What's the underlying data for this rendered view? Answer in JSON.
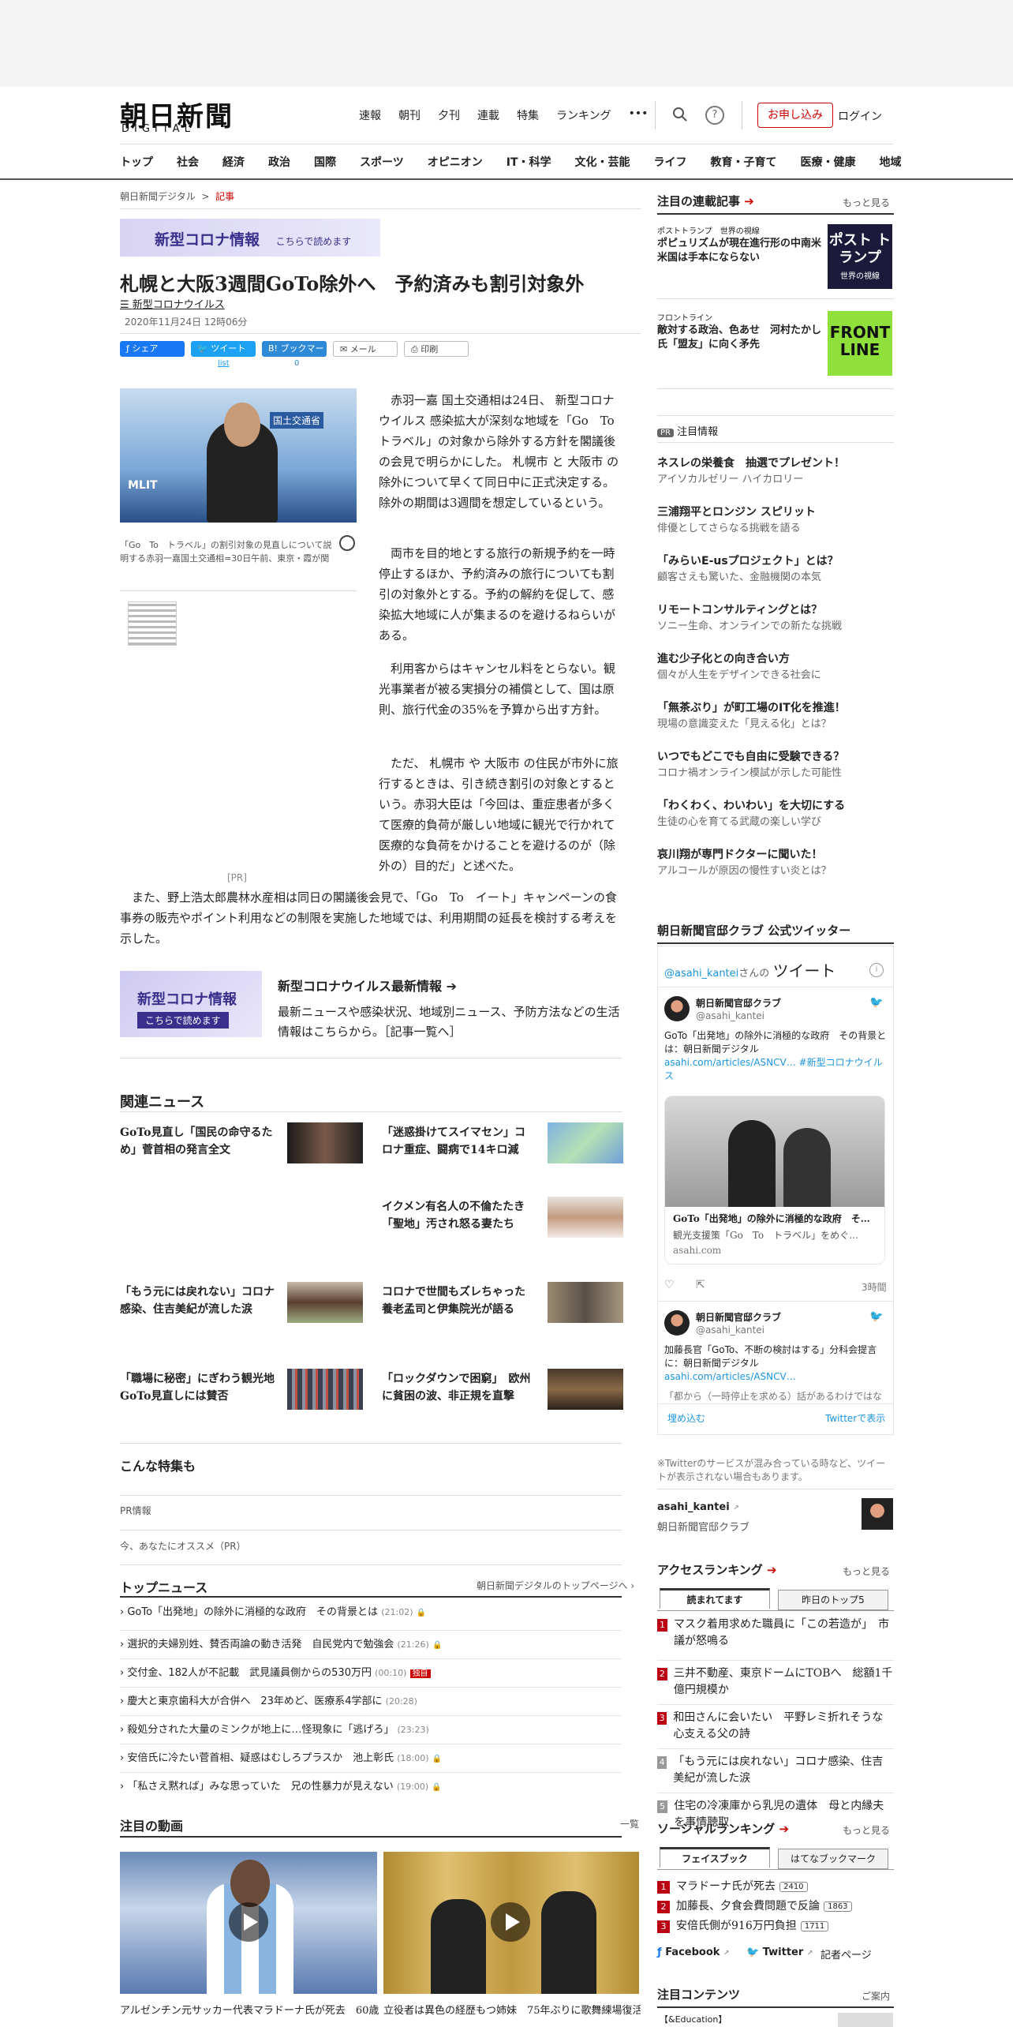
{
  "header": {
    "logo_ja": "朝日新聞",
    "logo_en": "DIGITAL",
    "topnav": [
      "速報",
      "朝刊",
      "夕刊",
      "連載",
      "特集",
      "ランキング"
    ],
    "more": "•••",
    "apply_label": "お申し込み",
    "login_label": "ログイン"
  },
  "catnav": [
    "トップ",
    "社会",
    "経済",
    "政治",
    "国際",
    "スポーツ",
    "オピニオン",
    "IT・科学",
    "文化・芸能",
    "ライフ",
    "教育・子育て",
    "医療・健康",
    "地域"
  ],
  "breadcrumb": {
    "home": "朝日新聞デジタル",
    "sep": ">",
    "current": "記事"
  },
  "corona_banner": {
    "title": "新型コロナ情報",
    "sub": "こちらで読めます"
  },
  "article": {
    "headline": "札幌と大阪3週間GoTo除外へ　予約済みも割引対象外",
    "tag": "新型コロナウイルス",
    "date": "2020年11月24日 12時06分",
    "share": {
      "facebook": "シェア",
      "twitter": "ツイート",
      "twitter_list": "list",
      "hatena": "ブックマーク",
      "hatena_count": "0",
      "mail": "メール",
      "print": "印刷"
    },
    "photo_caption": "「Go　To　トラベル」の割引対象の見直しについて説明する赤羽一嘉国土交通相=30日午前、東京・霞が関",
    "photo_text": "MLIT",
    "photo_sign": "国土交通省",
    "p1": "　赤羽一嘉 国土交通相は24日、 新型コロナウイルス 感染拡大が深刻な地域を「Go　To　トラベル」の対象から除外する方針を閣議後の会見で明らかにした。 札幌市 と 大阪市 の除外について早くて同日中に正式決定する。除外の期間は3週間を想定しているという。",
    "p2": "　両市を目的地とする旅行の新規予約を一時停止するほか、予約済みの旅行についても割引の対象外とする。予約の解約を促して、感染拡大地域に人が集まるのを避けるねらいがある。",
    "p3": "　利用客からはキャンセル料をとらない。観光事業者が被る実損分の補償として、国は原則、旅行代金の35%を予算から出す方針。",
    "p4": "　ただ、 札幌市 や 大阪市 の住民が市外に旅行するときは、引き続き割引の対象とするという。赤羽大臣は「今回は、重症患者が多くて医療的負荷が厳しい地域に観光で行かれて医療的な負荷をかけることを避けるのが（除外の）目的だ」と述べた。",
    "p5": "　また、野上浩太郎農林水産相は同日の閣議後会見で、「Go　To　イート」キャンペーンの食事券の販売やポイント利用などの制限を実施した地域では、利用期間の延長を検討する考えを示した。",
    "pr": "[PR]"
  },
  "promo": {
    "box_title": "新型コロナ情報",
    "box_sub": "こちらで読めます",
    "heading": "新型コロナウイルス最新情報",
    "body": "最新ニュースや感染状況、地域別ニュース、予防方法などの生活情報はこちらから。［記事一覧へ］"
  },
  "related": {
    "title": "関連ニュース",
    "items": [
      "GoTo見直し「国民の命守るため」菅首相の発言全文",
      "「迷惑掛けてスイマセン」コロナ重症、闘病で14キロ減",
      "イクメン有名人の不倫たたき　「聖地」汚され怒る妻たち",
      "「もう元には戻れない」コロナ感染、住吉美紀が流した涙",
      "コロナで世間もズレちゃった　養老孟司と伊集院光が語る",
      "「職場に秘密」にぎわう観光地　GoTo見直しには賛否",
      "「ロックダウンで困窮」　欧州に貧困の波、非正規を直撃"
    ]
  },
  "features": {
    "title": "こんな特集も",
    "pr": "PR情報",
    "recommend": "今、あなたにオススメ（PR）"
  },
  "top_news": {
    "title": "トップニュース",
    "link": "朝日新聞デジタルのトップページへ",
    "items": [
      {
        "text": "GoTo「出発地」の除外に消極的な政府　その背景とは",
        "time": "(21:02)",
        "lock": "🔒"
      },
      {
        "text": "選択的夫婦別姓、賛否両論の動き活発　自民党内で勉強会",
        "time": "(21:26)",
        "lock": "🔒"
      },
      {
        "text": "交付金、182人が不記載　武見議員側からの530万円",
        "time": "(00:10)",
        "badge": "独自"
      },
      {
        "text": "慶大と東京歯科大が合併へ　23年めど、医療系4学部に",
        "time": "(20:28)"
      },
      {
        "text": "殺処分された大量のミンクが地上に…怪現象に「逃げろ」",
        "time": "(23:23)"
      },
      {
        "text": "安倍氏に冷たい菅首相、疑惑はむしろプラスか　池上彰氏",
        "time": "(18:00)",
        "lock": "🔒"
      },
      {
        "text": "「私さえ黙れば」みな思っていた　兄の性暴力が見えない",
        "time": "(19:00)",
        "lock": "🔒"
      }
    ]
  },
  "videos": {
    "title": "注目の動画",
    "link": "一覧",
    "items": [
      "アルゼンチン元サッカー代表マラドーナ氏が死去　60歳",
      "立役者は異色の経歴もつ姉妹　75年ぶりに歌舞練場復活"
    ]
  },
  "sidebar": {
    "series": {
      "title": "注目の連載記事",
      "more": "もっと見る",
      "items": [
        {
          "kicker": "ポストトランプ　世界の視線",
          "title": "ポピュリズムが現在進行形の中南米　米国は手本にならない",
          "img_text": "ポスト トランプ",
          "img_sub": "世界の視線"
        },
        {
          "kicker": "フロントライン",
          "title": "敵対する政治、色あせ　河村たかし氏「盟友」に向く矛先",
          "img_text": "FRONT LINE"
        }
      ]
    },
    "pr_title": "注目情報",
    "pr_badge": "PR",
    "pr_items": [
      {
        "title": "ネスレの栄養食　抽選でプレゼント！",
        "sub": "アイソカルゼリー ハイカロリー"
      },
      {
        "title": "三浦翔平とロンジン スピリット",
        "sub": "俳優としてさらなる挑戦を語る"
      },
      {
        "title": "「みらいE-usプロジェクト」とは？",
        "sub": "顧客さえも驚いた、金融機関の本気"
      },
      {
        "title": "リモートコンサルティングとは？",
        "sub": "ソニー生命、オンラインでの新たな挑戦"
      },
      {
        "title": "進む少子化との向き合い方",
        "sub": "個々が人生をデザインできる社会に"
      },
      {
        "title": "「無茶ぶり」が町工場のIT化を推進！",
        "sub": "現場の意識変えた「見える化」とは？"
      },
      {
        "title": "いつでもどこでも自由に受験できる？",
        "sub": "コロナ禍オンライン模試が示した可能性"
      },
      {
        "title": "「わくわく、わいわい」を大切にする",
        "sub": "生徒の心を育てる武蔵の楽しい学び"
      },
      {
        "title": "哀川翔が専門ドクターに聞いた！",
        "sub": "アルコールが原因の慢性すい炎とは？"
      }
    ],
    "twitter": {
      "section_title": "朝日新聞官邸クラブ 公式ツイッター",
      "handle_head": "@asahi_kantei",
      "handle_suffix": "さんの",
      "tweet_label": "ツイート",
      "info": "i",
      "t1_name": "朝日新聞官邸クラブ",
      "t1_handle": "@asahi_kantei",
      "t1_text": "GoTo「出発地」の除外に消極的な政府　その背景とは：朝日新聞デジタル",
      "t1_link": "asahi.com/articles/ASNCV…",
      "t1_hashtag": "#新型コロナウイルス",
      "card_title": "GoTo「出発地」の除外に消極的な政府　そ…",
      "card_desc": "観光支援策「Go　To　トラベル」をめぐ…",
      "card_domain": "asahi.com",
      "t1_time": "3時間",
      "t2_name": "朝日新聞官邸クラブ",
      "t2_handle": "@asahi_kantei",
      "t2_text": "加藤長官「GoTo、不断の検討はする」分科会提言に：朝日新聞デジタル",
      "t2_link": "asahi.com/articles/ASNCV…",
      "t3_text": "「都から（一時停止を求める）話があるわけではな",
      "embed": "埋め込む",
      "view": "Twitterで表示",
      "note": "※Twitterのサービスが混み合っている時など、ツイートが表示されない場合もあります。",
      "account_id": "asahi_kantei",
      "account_name": "朝日新聞官邸クラブ"
    },
    "access": {
      "title": "アクセスランキング",
      "more": "もっと見る",
      "tab1": "読まれてます",
      "tab2": "昨日のトップ5",
      "items": [
        "マスク着用求めた職員に「この若造が」　市議が怒鳴る",
        "三井不動産、東京ドームにTOBへ　総額1千億円規模か",
        "和田さんに会いたい　平野レミ折れそうな心支える父の詩",
        "「もう元には戻れない」コロナ感染、住吉美紀が流した涙",
        "住宅の冷凍庫から乳児の遺体　母と内縁夫を事情聴取"
      ]
    },
    "social": {
      "title": "ソーシャルランキング",
      "more": "もっと見る",
      "tab1": "フェイスブック",
      "tab2": "はてなブックマーク",
      "items": [
        {
          "text": "マラドーナ氏が死去",
          "count": "2410"
        },
        {
          "text": "加藤長、夕食会費問題で反論",
          "count": "1863"
        },
        {
          "text": "安倍氏側が916万円負担",
          "count": "1711"
        }
      ],
      "fb": "Facebook",
      "tw": "Twitter",
      "reporter": "記者ページ"
    },
    "contents": {
      "title": "注目コンテンツ",
      "link": "ご案内",
      "first": "【&Education】"
    }
  }
}
